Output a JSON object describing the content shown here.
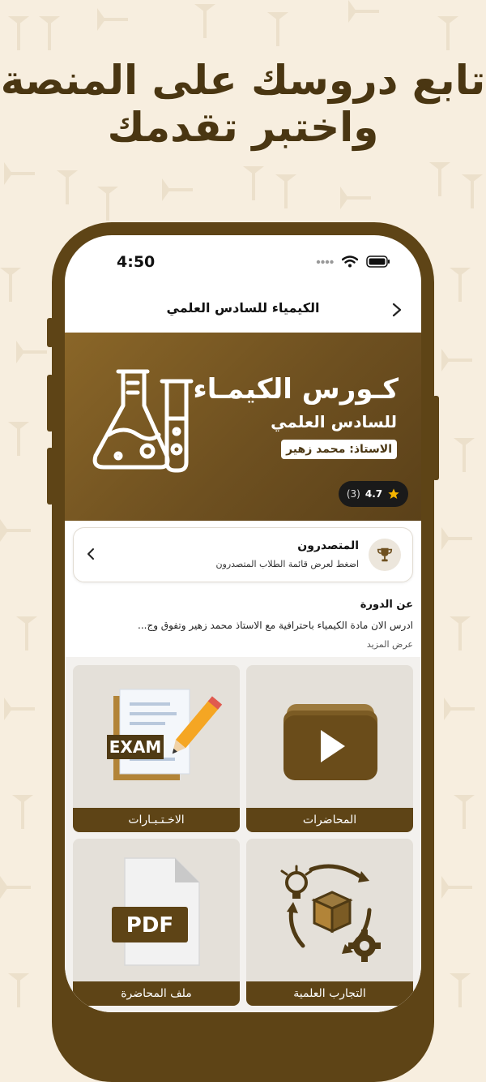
{
  "headline": {
    "line1": "تابع دروسك على المنصة",
    "line2": "واختبر تقدمك"
  },
  "status_bar": {
    "time": "4:50"
  },
  "app_bar": {
    "title": "الكيمياء للسادس العلمي",
    "back_icon": "chevron-right-icon"
  },
  "hero": {
    "title": "كـورس الكيمـاء",
    "subtitle": "للسادس العلمي",
    "teacher": "الاستاذ: محمد زهير",
    "rating_value": "4.7",
    "rating_count": "(3)",
    "icon": "chemistry-flasks-icon"
  },
  "toppers": {
    "title": "المتصدرون",
    "subtitle": "اضغط لعرض قائمة الطلاب المتصدرون",
    "icon": "trophy-icon"
  },
  "about": {
    "title": "عن الدورة",
    "text": "ادرس الان مادة الكيمياء باحترافية مع الاستاذ محمد زهير وتفوق وج...",
    "more": "عرض المزيد"
  },
  "cards": [
    {
      "label": "المحاضرات",
      "icon": "video-play-icon"
    },
    {
      "label": "الاخـتـبـارات",
      "icon": "exam-pencil-icon"
    },
    {
      "label": "التجارب العلمية",
      "icon": "experiment-box-gear-icon"
    },
    {
      "label": "ملف المحاضرة",
      "icon": "pdf-file-icon"
    }
  ],
  "colors": {
    "brand": "#5e4416",
    "background": "#f7eedf",
    "hero_gradient_start": "#8a6628",
    "hero_gradient_end": "#5b4119",
    "star": "#f5b400"
  }
}
